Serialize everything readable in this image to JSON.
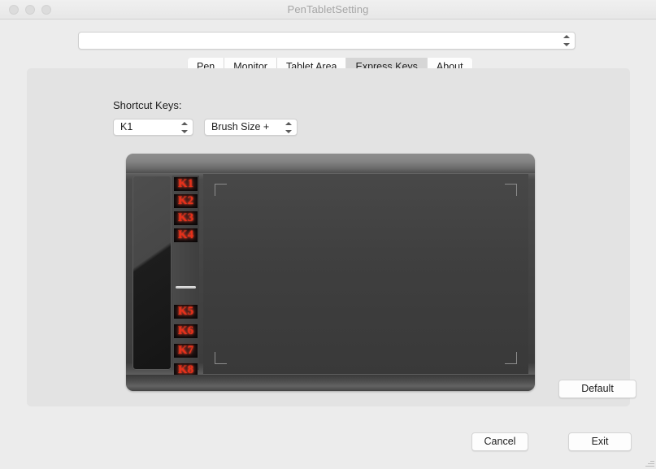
{
  "window": {
    "title": "PenTabletSetting",
    "traffic_lights": [
      "close-button",
      "minimize-button",
      "maximize-button"
    ]
  },
  "device_selector": {
    "value": "",
    "placeholder": "",
    "icon": "stepper-chevrons-icon"
  },
  "tabs": [
    {
      "label": "Pen",
      "selected": false
    },
    {
      "label": "Monitor",
      "selected": false
    },
    {
      "label": "Tablet Area",
      "selected": false
    },
    {
      "label": "Express Keys",
      "selected": true
    },
    {
      "label": "About",
      "selected": false
    }
  ],
  "express_keys": {
    "section_label": "Shortcut Keys:",
    "key_select": {
      "value": "K1",
      "icon": "stepper-chevrons-icon"
    },
    "function_select": {
      "value": "Brush Size +",
      "icon": "stepper-chevrons-icon"
    },
    "tablet_illustration": {
      "keys_upper": [
        "K1",
        "K2",
        "K3",
        "K4"
      ],
      "keys_lower": [
        "K5",
        "K6",
        "K7",
        "K8"
      ],
      "key_text_color": "#e8301a",
      "body_color": "#434343",
      "active_area_color": "#3f3f3f"
    }
  },
  "buttons": {
    "default_label": "Default",
    "cancel_label": "Cancel",
    "exit_label": "Exit"
  },
  "colors": {
    "window_background": "#ececec",
    "panel_background": "#e3e3e3",
    "tab_selected_background": "#d6d6d6",
    "title_text": "#a6a6a6"
  }
}
